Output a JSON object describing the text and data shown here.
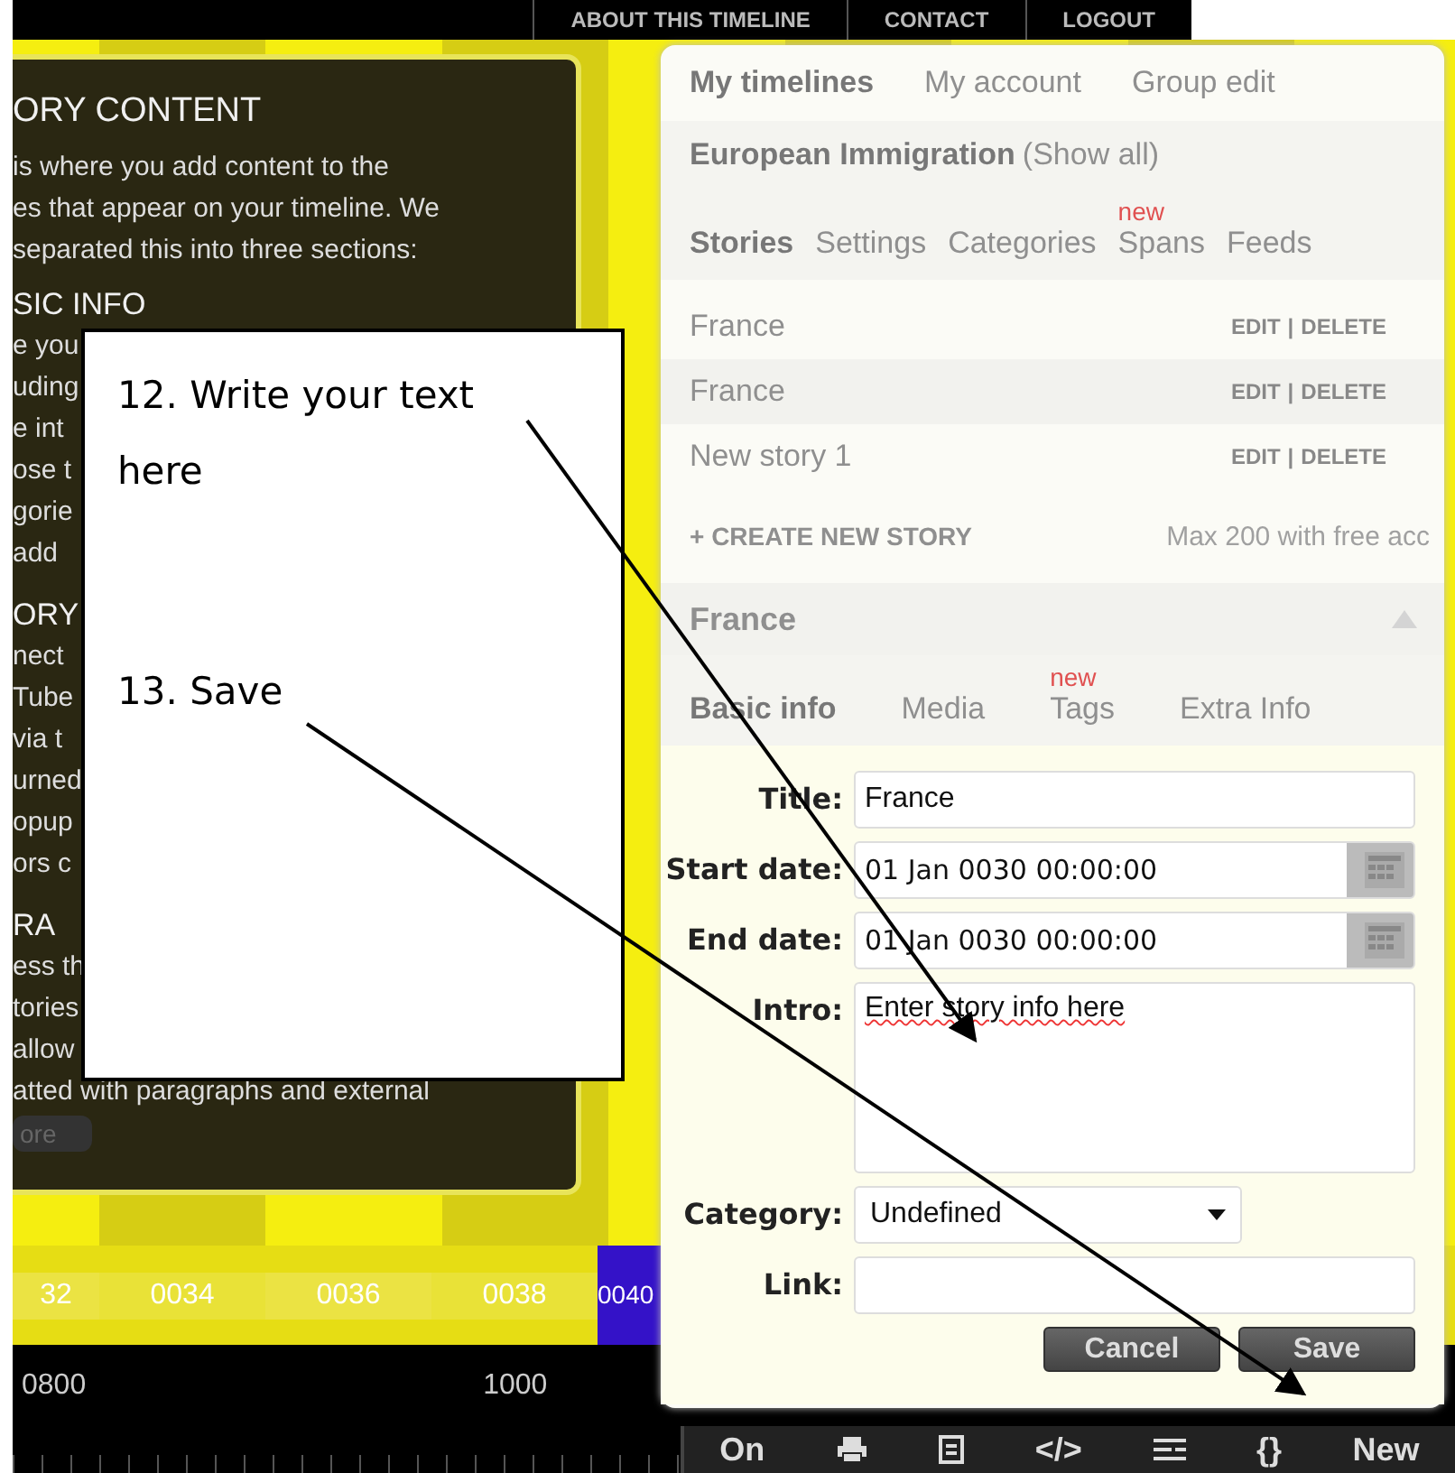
{
  "top_nav": [
    "ABOUT THIS TIMELINE",
    "CONTACT",
    "LOGOUT"
  ],
  "info_panel": {
    "heading": "ORY CONTENT",
    "lines": [
      "is where you add content to the",
      "es that appear on your timeline. We",
      "separated this into three sections:"
    ],
    "section": "SIC INFO",
    "fragments": [
      {
        "kind": "line",
        "text": "e you"
      },
      {
        "kind": "line",
        "text": "uding"
      },
      {
        "kind": "line",
        "text": "e int"
      },
      {
        "kind": "line",
        "text": "ose t"
      },
      {
        "kind": "line",
        "text": "gorie"
      },
      {
        "kind": "line",
        "text": "add"
      },
      {
        "kind": "heading",
        "text": "ORY"
      },
      {
        "kind": "line",
        "text": "nect"
      },
      {
        "kind": "line",
        "text": "Tube"
      },
      {
        "kind": "line",
        "text": "via t"
      },
      {
        "kind": "line",
        "text": "urned"
      },
      {
        "kind": "line",
        "text": "opup"
      },
      {
        "kind": "line",
        "text": "ors c"
      },
      {
        "kind": "heading",
        "text": "RA"
      },
      {
        "kind": "line",
        "text": "ess th"
      },
      {
        "kind": "line",
        "text": "tories"
      },
      {
        "kind": "line",
        "text": "allow"
      }
    ],
    "last_line": "atted with paragraphs and external",
    "more_button": "ore"
  },
  "timeline": {
    "years": [
      "32",
      "0034",
      "0036",
      "0038",
      "0040"
    ],
    "axis": [
      "0800",
      "1000"
    ]
  },
  "callout": {
    "steps": [
      "12. Write your text here",
      "13. Save"
    ]
  },
  "editor": {
    "tabs": [
      {
        "label": "My timelines",
        "selected": true
      },
      {
        "label": "My account",
        "selected": false
      },
      {
        "label": "Group edit",
        "selected": false
      }
    ],
    "timeline_name": "European Immigration",
    "show_all": "(Show all)",
    "subtabs": [
      {
        "label": "Stories",
        "selected": true
      },
      {
        "label": "Settings",
        "selected": false
      },
      {
        "label": "Categories",
        "selected": false
      },
      {
        "label": "Spans",
        "selected": false,
        "badge": "new"
      },
      {
        "label": "Feeds",
        "selected": false
      }
    ],
    "stories": [
      {
        "title": "France",
        "edit": "EDIT",
        "separator": "|",
        "delete": "DELETE"
      },
      {
        "title": "France",
        "edit": "EDIT",
        "separator": "|",
        "delete": "DELETE"
      },
      {
        "title": "New story 1",
        "edit": "EDIT",
        "separator": "|",
        "delete": "DELETE"
      }
    ],
    "create": "+ CREATE NEW STORY",
    "limit": "Max 200 with free acc",
    "story_title": "France",
    "story_tabs": [
      {
        "label": "Basic info",
        "selected": true
      },
      {
        "label": "Media",
        "selected": false
      },
      {
        "label": "Tags",
        "selected": false,
        "badge": "new"
      },
      {
        "label": "Extra Info",
        "selected": false
      }
    ],
    "form": [
      {
        "kind": "text",
        "label": "Title:",
        "value": "France"
      },
      {
        "kind": "date",
        "label": "Start date:",
        "value": "01 Jan 0030 00:00:00"
      },
      {
        "kind": "date",
        "label": "End date:",
        "value": "01 Jan 0030 00:00:00"
      },
      {
        "kind": "textarea",
        "label": "Intro:",
        "value": "Enter story info here"
      },
      {
        "kind": "select",
        "label": "Category:",
        "value": "Undefined"
      },
      {
        "kind": "text",
        "label": "Link:"
      }
    ],
    "buttons": [
      "Cancel",
      "Save"
    ]
  },
  "toolbar": {
    "on": "On",
    "code": "</>",
    "braces": "{}",
    "new": "New"
  }
}
